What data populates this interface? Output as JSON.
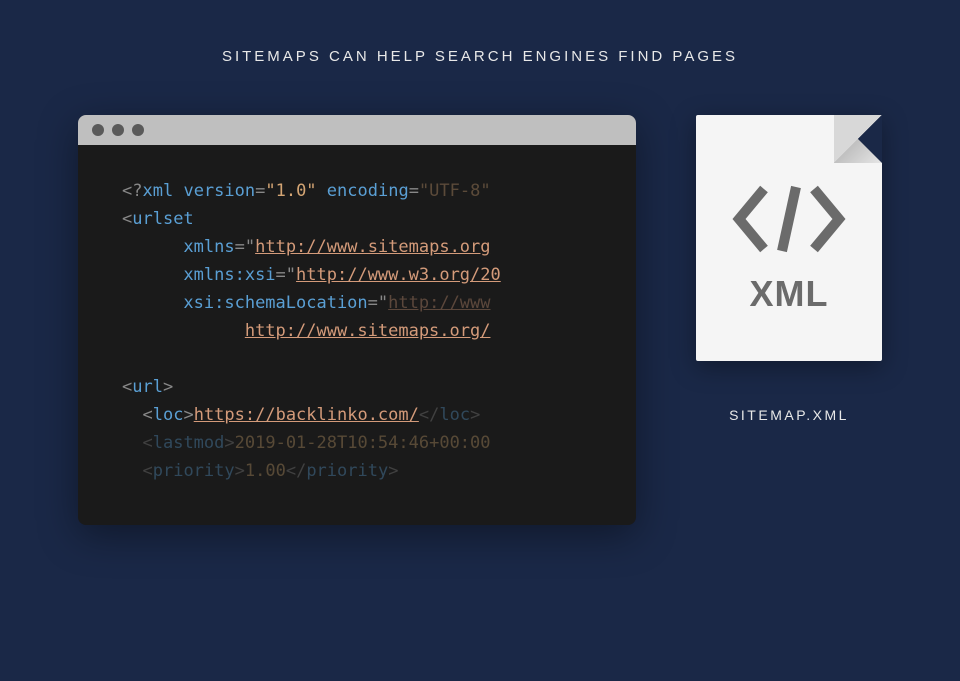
{
  "heading": "SITEMAPS CAN HELP SEARCH ENGINES FIND PAGES",
  "code": {
    "xml_decl_open": "<?",
    "xml_decl_tag": "xml",
    "version_attr": "version",
    "version_val": "\"1.0\"",
    "encoding_attr": "encoding",
    "encoding_val": "\"UTF-8\"",
    "urlset_open": "<",
    "urlset_tag": "urlset",
    "xmlns_attr": "xmlns",
    "xmlns_val": "http://www.sitemaps.org",
    "xmlns_xsi_attr": "xmlns:xsi",
    "xmlns_xsi_val": "http://www.w3.org/20",
    "schema_attr": "xsi:schemaLocation",
    "schema_val1": "http://www",
    "schema_val2": "http://www.sitemaps.org/",
    "url_open": "<",
    "url_tag": "url",
    "url_close": ">",
    "loc_open": "<",
    "loc_tag": "loc",
    "loc_close": ">",
    "loc_val": "https://backlinko.com/",
    "loc_end_open": "</",
    "loc_end_tag": "loc",
    "loc_end_close": ">",
    "lastmod_open": "<",
    "lastmod_tag": "lastmod",
    "lastmod_close": ">",
    "lastmod_val": "2019-01-28T10:54:46+00:00",
    "priority_open": "<",
    "priority_tag": "priority",
    "priority_close": ">",
    "priority_val": "1.00",
    "priority_end_open": "</",
    "priority_end_tag": "priority",
    "priority_end_close": ">"
  },
  "file": {
    "ext_label": "XML",
    "filename": "SITEMAP.XML"
  }
}
